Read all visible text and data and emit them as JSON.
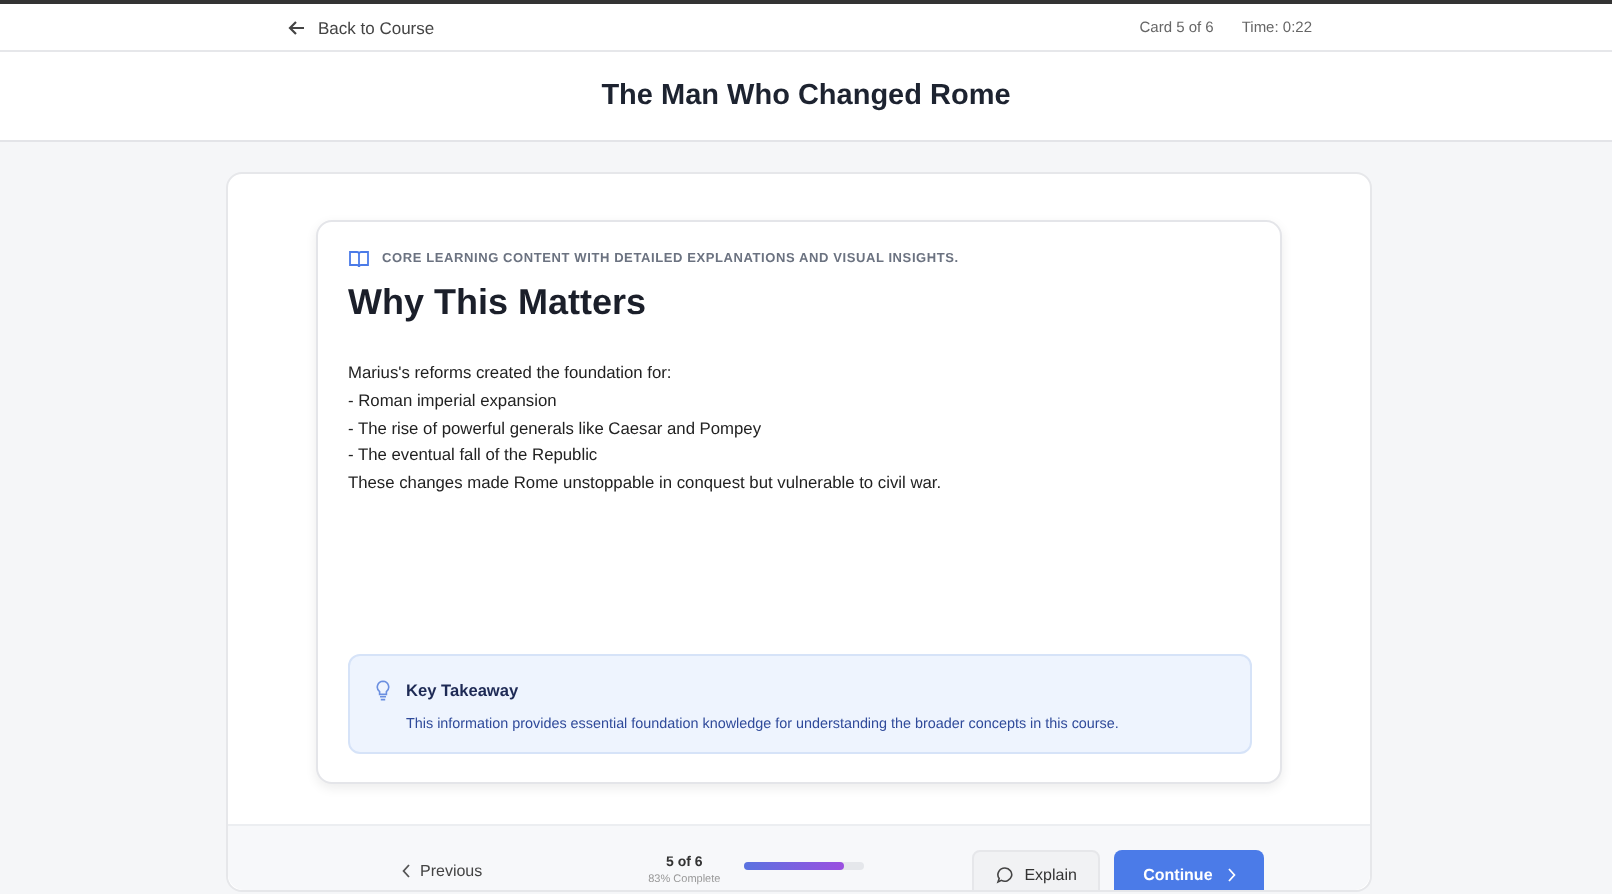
{
  "top_bar": {
    "back_link": "Back to Course",
    "card_counter": "Card 5 of 6",
    "timer": "Time: 0:22"
  },
  "page_title": "The Man Who Changed Rome",
  "card": {
    "eyebrow": "CORE LEARNING CONTENT WITH DETAILED EXPLANATIONS AND VISUAL INSIGHTS.",
    "heading": "Why This Matters",
    "body_lines": [
      "Marius's reforms created the foundation for:",
      "- Roman imperial expansion",
      "- The rise of powerful generals like Caesar and Pompey",
      "- The eventual fall of the Republic",
      "These changes made Rome unstoppable in conquest but vulnerable to civil war."
    ],
    "takeaway": {
      "title": "Key Takeaway",
      "text": "This information provides essential foundation knowledge for understanding the broader concepts in this course."
    }
  },
  "footer": {
    "previous": "Previous",
    "position": "5 of 6",
    "percent": "83% Complete",
    "level": 0.83,
    "explain": "Explain",
    "continue": "Continue"
  }
}
